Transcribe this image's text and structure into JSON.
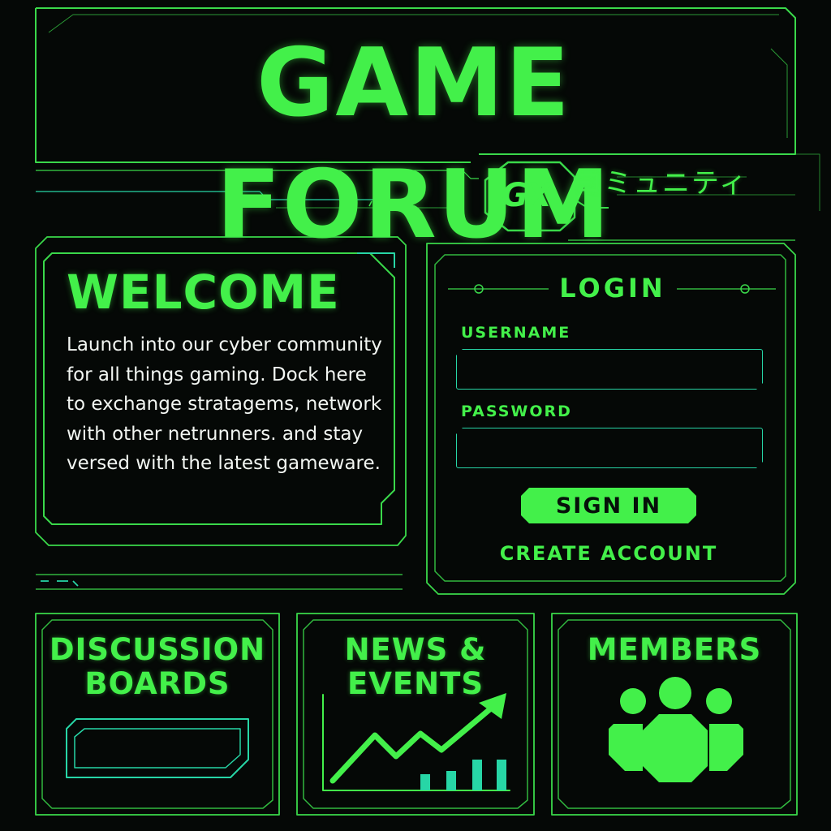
{
  "header": {
    "title": "GAME FORUM",
    "logo": {
      "badge_text": "GX",
      "subtitle_jp": "コミュニティ"
    }
  },
  "welcome": {
    "heading": "WELCOME",
    "body": "Launch into our cyber community for all things gaming. Dock here to exchange stratagems, network with other netrunners. and stay versed with the latest gameware."
  },
  "login": {
    "heading": "LOGIN",
    "username_label": "USERNAME",
    "username_value": "",
    "password_label": "PASSWORD",
    "password_value": "",
    "sign_in_label": "SIGN IN",
    "create_account_label": "CREATE ACCOUNT"
  },
  "cards": {
    "discussion": {
      "title_line1": "DISCUSSION",
      "title_line2": "BOARDS",
      "icon": "panel-icon"
    },
    "news": {
      "title_line1": "NEWS &",
      "title_line2": "EVENTS",
      "icon": "trend-chart-icon"
    },
    "members": {
      "title": "MEMBERS",
      "icon": "group-icon"
    }
  },
  "colors": {
    "accent": "#43f04a",
    "teal": "#27d6a6",
    "background": "#050806",
    "text": "#f2f6f2"
  }
}
